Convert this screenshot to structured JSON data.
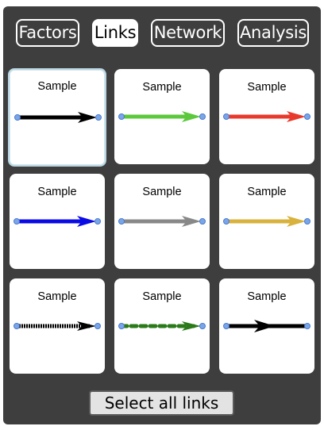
{
  "tabs": [
    {
      "label": "Factors",
      "active": false
    },
    {
      "label": "Links",
      "active": true
    },
    {
      "label": "Network",
      "active": false
    },
    {
      "label": "Analysis",
      "active": false
    }
  ],
  "link_styles": [
    {
      "label": "Sample",
      "color": "#000000",
      "style": "solid",
      "selected": true
    },
    {
      "label": "Sample",
      "color": "#5cc83c",
      "style": "solid",
      "selected": false
    },
    {
      "label": "Sample",
      "color": "#e83a2c",
      "style": "solid",
      "selected": false
    },
    {
      "label": "Sample",
      "color": "#0a0ae6",
      "style": "solid",
      "selected": false
    },
    {
      "label": "Sample",
      "color": "#888888",
      "style": "solid",
      "selected": false
    },
    {
      "label": "Sample",
      "color": "#d8b23c",
      "style": "solid",
      "selected": false
    },
    {
      "label": "Sample",
      "color": "#000000",
      "style": "dotted",
      "selected": false
    },
    {
      "label": "Sample",
      "color": "#2a7a1a",
      "style": "dashed",
      "selected": false
    },
    {
      "label": "Sample",
      "color": "#000000",
      "style": "mid-arrow",
      "selected": false
    }
  ],
  "select_all_label": "Select all links",
  "endpoint_color": "#7aa6e8"
}
